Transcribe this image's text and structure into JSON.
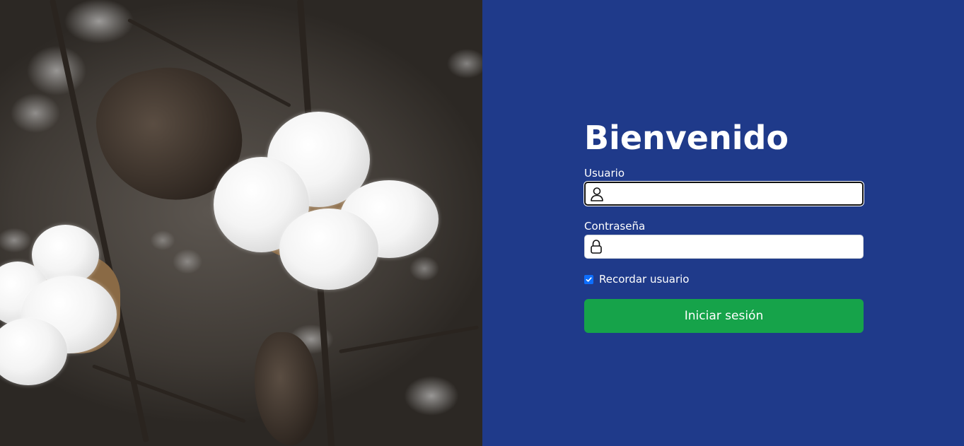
{
  "login": {
    "title": "Bienvenido",
    "username_label": "Usuario",
    "username_value": "",
    "password_label": "Contraseña",
    "password_value": "",
    "remember_label": "Recordar usuario",
    "remember_checked": true,
    "submit_label": "Iniciar sesión"
  },
  "icons": {
    "username": "person-icon",
    "password": "lock-icon",
    "remember": "checkmark-icon"
  },
  "colors": {
    "panel_background": "#1f3a8a",
    "submit_button": "#16a34a",
    "checkbox": "#0d6efd",
    "text": "#ffffff"
  }
}
